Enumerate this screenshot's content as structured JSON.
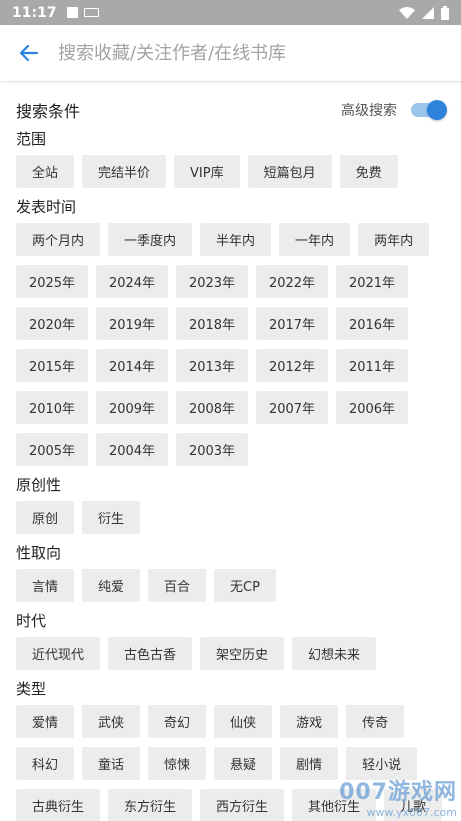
{
  "status_bar": {
    "time": "11:17"
  },
  "toolbar": {
    "search_placeholder": "搜索收藏/关注作者/在线书库"
  },
  "conditions": {
    "title": "搜索条件",
    "advanced_label": "高级搜索"
  },
  "sections": [
    {
      "label": "范围",
      "options": [
        "全站",
        "完结半价",
        "VIP库",
        "短篇包月",
        "免费"
      ]
    },
    {
      "label": "发表时间",
      "options": [
        "两个月内",
        "一季度内",
        "半年内",
        "一年内",
        "两年内"
      ],
      "years": [
        "2025年",
        "2024年",
        "2023年",
        "2022年",
        "2021年",
        "2020年",
        "2019年",
        "2018年",
        "2017年",
        "2016年",
        "2015年",
        "2014年",
        "2013年",
        "2012年",
        "2011年",
        "2010年",
        "2009年",
        "2008年",
        "2007年",
        "2006年",
        "2005年",
        "2004年",
        "2003年"
      ]
    },
    {
      "label": "原创性",
      "options": [
        "原创",
        "衍生"
      ]
    },
    {
      "label": "性取向",
      "options": [
        "言情",
        "纯爱",
        "百合",
        "无CP"
      ]
    },
    {
      "label": "时代",
      "options": [
        "近代现代",
        "古色古香",
        "架空历史",
        "幻想未来"
      ]
    },
    {
      "label": "类型",
      "options": [
        "爱情",
        "武侠",
        "奇幻",
        "仙侠",
        "游戏",
        "传奇",
        "科幻",
        "童话",
        "惊悚",
        "悬疑",
        "剧情",
        "轻小说",
        "古典衍生",
        "东方衍生",
        "西方衍生",
        "其他衍生",
        "儿歌"
      ]
    }
  ],
  "watermark": {
    "big": "007游戏网",
    "small": "www.yx007.com"
  },
  "colors": {
    "accent": "#2d83dc",
    "chip_bg": "#ececec",
    "status_bar": "#a9a9a9"
  }
}
